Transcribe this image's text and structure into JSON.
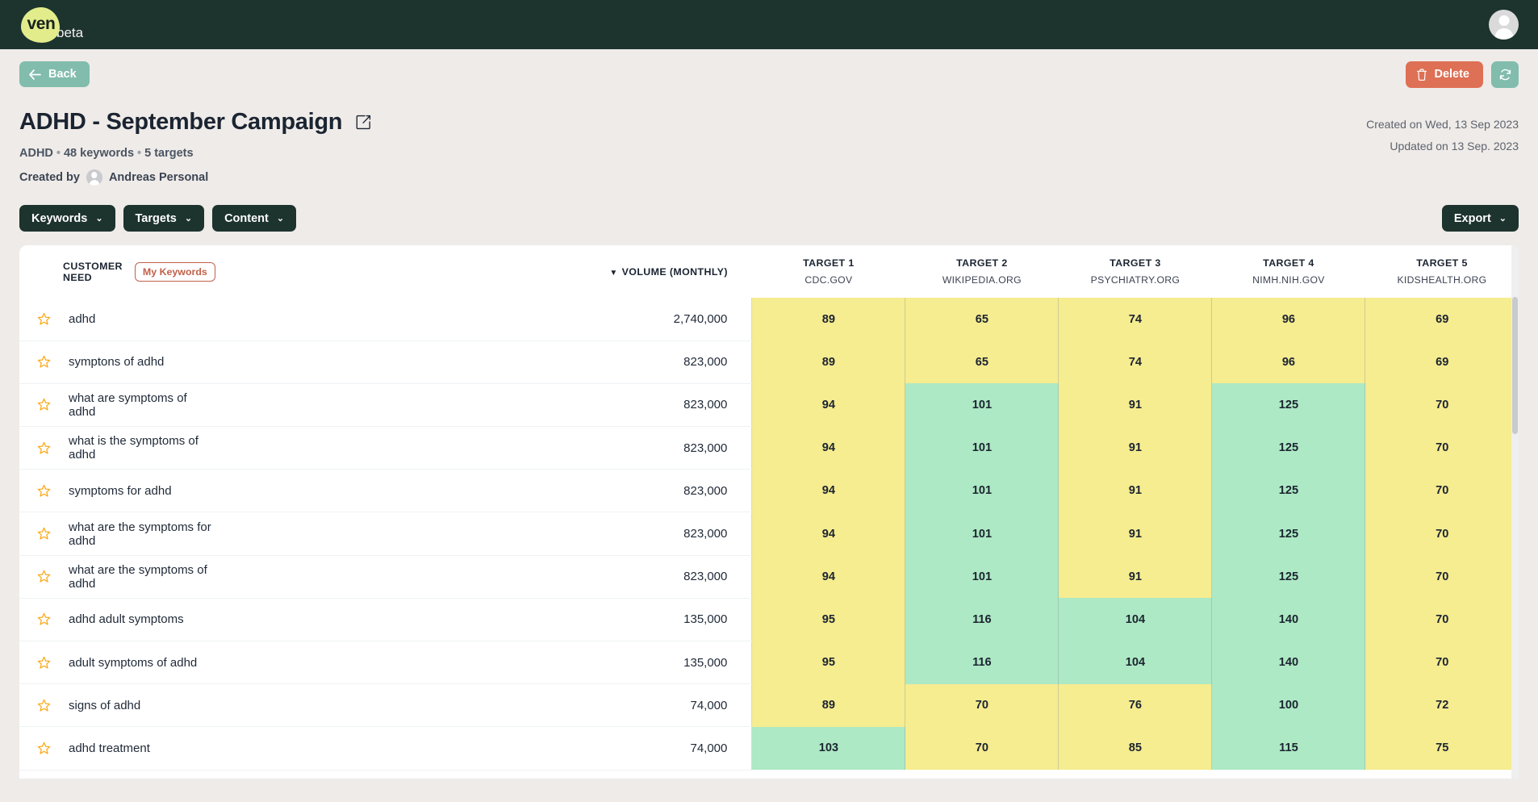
{
  "brand": {
    "logo_text": "ven",
    "beta_label": "beta"
  },
  "actions": {
    "back_label": "Back",
    "delete_label": "Delete",
    "refresh_icon": "refresh-icon",
    "back_icon": "arrow-left-icon",
    "delete_icon": "trash-icon"
  },
  "page": {
    "title": "ADHD - September Campaign",
    "edit_icon": "edit-square-icon",
    "meta_category": "ADHD",
    "meta_keywords": "48 keywords",
    "meta_targets": "5 targets",
    "created_by_label": "Created by",
    "created_by_name": "Andreas Personal",
    "created_on": "Created on Wed, 13 Sep 2023",
    "updated_on": "Updated on 13 Sep. 2023"
  },
  "toolbar": {
    "keywords_label": "Keywords",
    "targets_label": "Targets",
    "content_label": "Content",
    "export_label": "Export",
    "chevron": "⌄"
  },
  "colors": {
    "nav_dark": "#1D332E",
    "page_bg": "#EFEBE8",
    "accent_green": "#81BCAC",
    "accent_lime": "#E3EC8B",
    "delete_red": "#DE7055",
    "badge_terracotta": "#C0614A",
    "cell_yellow": "#F6EC90",
    "cell_green": "#ADE9C4",
    "star_orange": "#FBA919"
  },
  "table": {
    "need_header": "CUSTOMER NEED",
    "my_keywords_badge": "My Keywords",
    "volume_header": "VOLUME (MONTHLY)",
    "sort_caret": "▼",
    "targets": [
      {
        "label": "TARGET 1",
        "domain": "CDC.GOV"
      },
      {
        "label": "TARGET 2",
        "domain": "WIKIPEDIA.ORG"
      },
      {
        "label": "TARGET 3",
        "domain": "PSYCHIATRY.ORG"
      },
      {
        "label": "TARGET 4",
        "domain": "NIMH.NIH.GOV"
      },
      {
        "label": "TARGET 5",
        "domain": "KIDSHEALTH.ORG"
      }
    ],
    "rows": [
      {
        "keyword": "adhd",
        "volume": "2,740,000",
        "scores": [
          89,
          65,
          74,
          96,
          69
        ],
        "colors": [
          "y",
          "y",
          "y",
          "y",
          "y"
        ]
      },
      {
        "keyword": "symptons of adhd",
        "volume": "823,000",
        "scores": [
          89,
          65,
          74,
          96,
          69
        ],
        "colors": [
          "y",
          "y",
          "y",
          "y",
          "y"
        ]
      },
      {
        "keyword": "what are symptoms of adhd",
        "volume": "823,000",
        "scores": [
          94,
          101,
          91,
          125,
          70
        ],
        "colors": [
          "y",
          "g",
          "y",
          "g",
          "y"
        ]
      },
      {
        "keyword": "what is the symptoms of adhd",
        "volume": "823,000",
        "scores": [
          94,
          101,
          91,
          125,
          70
        ],
        "colors": [
          "y",
          "g",
          "y",
          "g",
          "y"
        ]
      },
      {
        "keyword": "symptoms for adhd",
        "volume": "823,000",
        "scores": [
          94,
          101,
          91,
          125,
          70
        ],
        "colors": [
          "y",
          "g",
          "y",
          "g",
          "y"
        ]
      },
      {
        "keyword": "what are the symptoms for adhd",
        "volume": "823,000",
        "scores": [
          94,
          101,
          91,
          125,
          70
        ],
        "colors": [
          "y",
          "g",
          "y",
          "g",
          "y"
        ]
      },
      {
        "keyword": "what are the symptoms of adhd",
        "volume": "823,000",
        "scores": [
          94,
          101,
          91,
          125,
          70
        ],
        "colors": [
          "y",
          "g",
          "y",
          "g",
          "y"
        ]
      },
      {
        "keyword": "adhd adult symptoms",
        "volume": "135,000",
        "scores": [
          95,
          116,
          104,
          140,
          70
        ],
        "colors": [
          "y",
          "g",
          "g",
          "g",
          "y"
        ]
      },
      {
        "keyword": "adult symptoms of adhd",
        "volume": "135,000",
        "scores": [
          95,
          116,
          104,
          140,
          70
        ],
        "colors": [
          "y",
          "g",
          "g",
          "g",
          "y"
        ]
      },
      {
        "keyword": "signs of adhd",
        "volume": "74,000",
        "scores": [
          89,
          70,
          76,
          100,
          72
        ],
        "colors": [
          "y",
          "y",
          "y",
          "g",
          "y"
        ]
      },
      {
        "keyword": "adhd treatment",
        "volume": "74,000",
        "scores": [
          103,
          70,
          85,
          115,
          75
        ],
        "colors": [
          "g",
          "y",
          "y",
          "g",
          "y"
        ]
      }
    ]
  }
}
